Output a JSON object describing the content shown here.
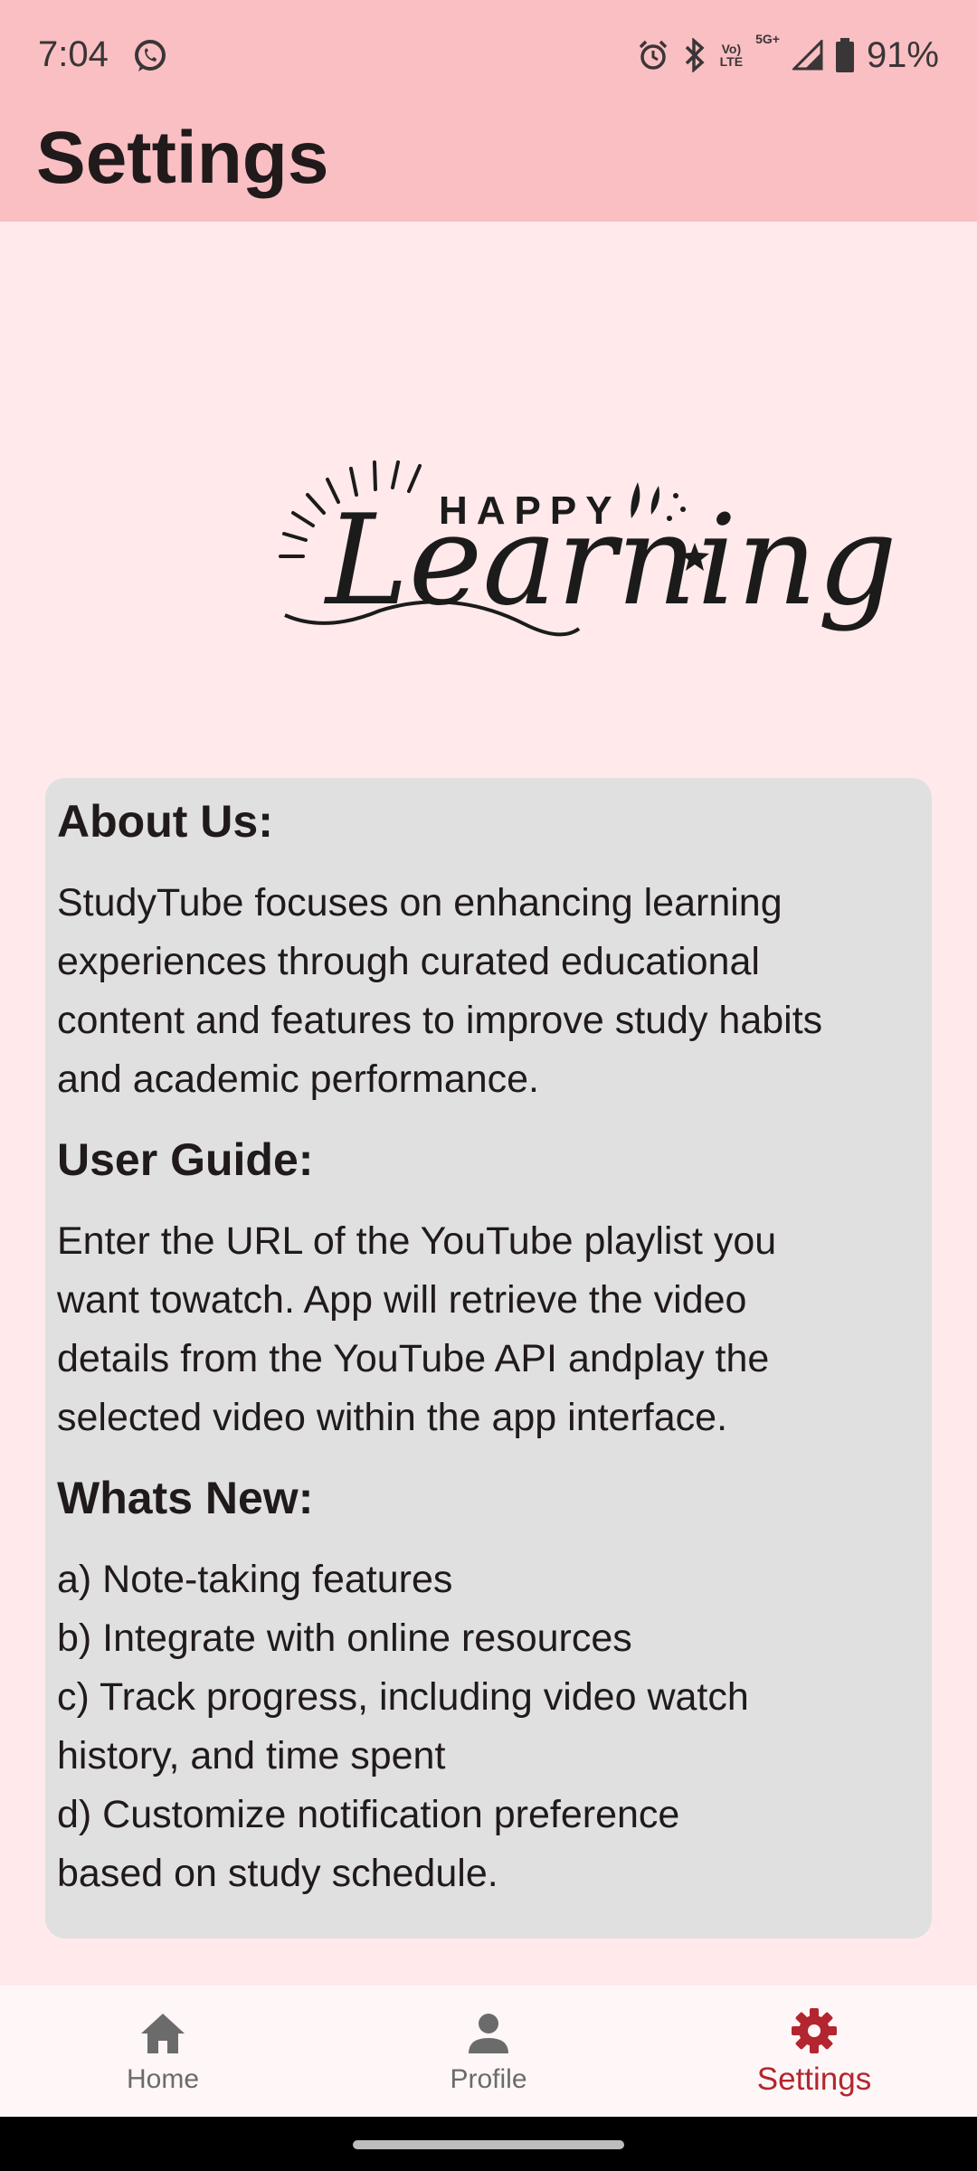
{
  "status_bar": {
    "time": "7:04",
    "battery": "91%",
    "net_a": "Vo)\nLTE",
    "net_b": "5G+"
  },
  "app_bar": {
    "title": "Settings"
  },
  "logo": {
    "top_text": "HAPPY",
    "script_text": "Learning"
  },
  "about": {
    "heading": "About Us:",
    "body": "StudyTube focuses on enhancing learning\nexperiences through  curated educational\ncontent and features to improve study habits\nand academic performance."
  },
  "guide": {
    "heading": "User Guide:",
    "body": "Enter the URL of the YouTube playlist you\nwant towatch. App will retrieve the video\ndetails from the YouTube API andplay the\nselected video within the app interface."
  },
  "whats_new": {
    "heading": "Whats New:",
    "items": [
      "a) Note-taking features",
      "b) Integrate with online resources",
      "c) Track progress, including video watch\n    history, and time spent",
      "d) Customize notification preference\n    based on study schedule."
    ]
  },
  "bottom_nav": {
    "items": [
      {
        "label": "Home",
        "icon": "home-icon"
      },
      {
        "label": "Profile",
        "icon": "person-icon"
      },
      {
        "label": "Settings",
        "icon": "gear-icon"
      }
    ],
    "active_index": 2,
    "active_color": "#b3262f",
    "inactive_color": "#6b6b6b"
  },
  "colors": {
    "app_bar": "#f9bfc3",
    "background": "#ffe9ea",
    "card": "#e0e0e0"
  }
}
